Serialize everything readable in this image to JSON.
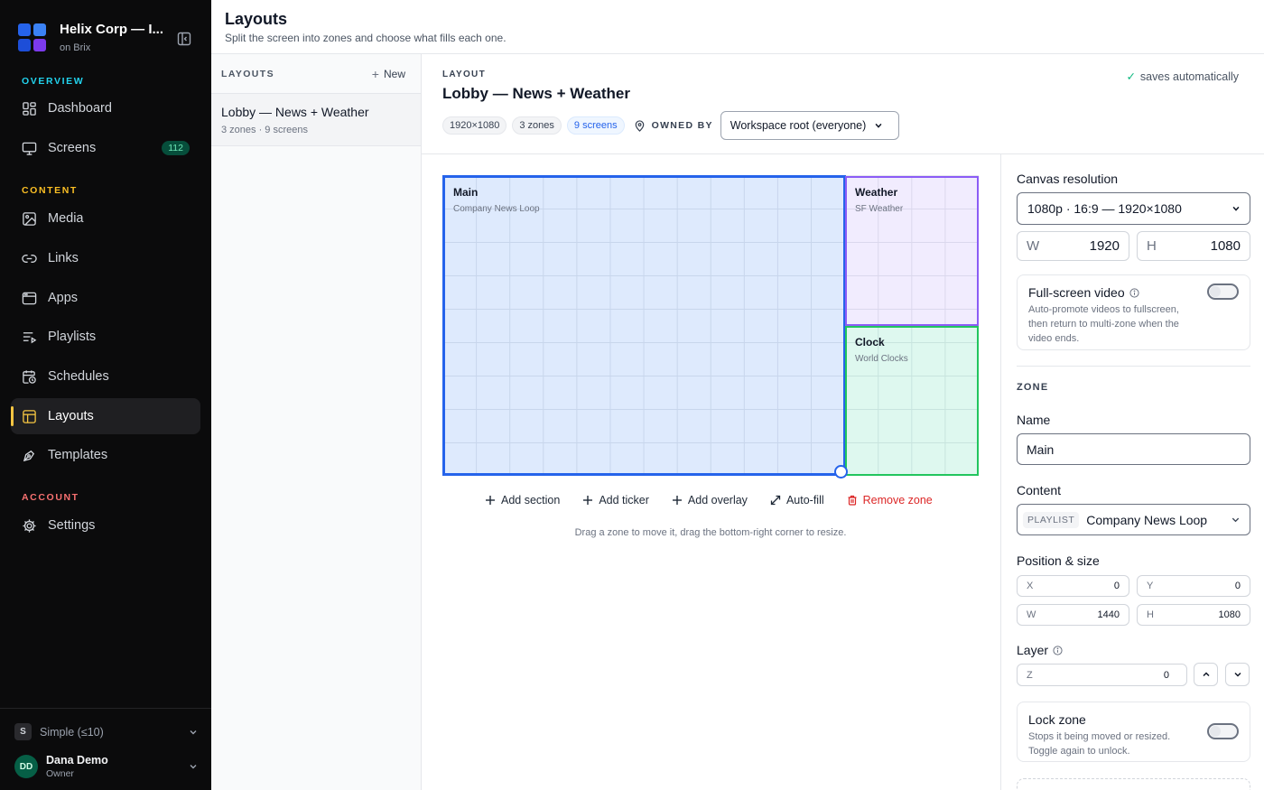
{
  "sidebar": {
    "brand_name": "Helix Corp — I...",
    "brand_sub": "on Brix",
    "logo_colors": [
      "#2563eb",
      "#3b82f6",
      "#1d4ed8",
      "#7c3aed"
    ],
    "sections": {
      "overview": "OVERVIEW",
      "content": "CONTENT",
      "account": "ACCOUNT"
    },
    "section_colors": {
      "overview": "#22d3ee",
      "content": "#fbbf24",
      "account": "#f87171"
    },
    "items": [
      {
        "label": "Dashboard",
        "icon": "dashboard-icon"
      },
      {
        "label": "Screens",
        "icon": "monitor-icon",
        "badge": "112"
      },
      {
        "label": "Media",
        "icon": "image-icon"
      },
      {
        "label": "Links",
        "icon": "link-icon"
      },
      {
        "label": "Apps",
        "icon": "app-window-icon"
      },
      {
        "label": "Playlists",
        "icon": "playlist-icon"
      },
      {
        "label": "Schedules",
        "icon": "calendar-clock-icon"
      },
      {
        "label": "Layouts",
        "icon": "layout-icon",
        "active": true
      },
      {
        "label": "Templates",
        "icon": "pen-tool-icon"
      },
      {
        "label": "Settings",
        "icon": "gear-icon"
      }
    ],
    "plan": {
      "letter": "S",
      "label": "Simple (≤10)"
    },
    "user": {
      "initials": "DD",
      "name": "Dana Demo",
      "role": "Owner"
    }
  },
  "header": {
    "title": "Layouts",
    "subtitle": "Split the screen into zones and choose what fills each one."
  },
  "layouts_panel": {
    "title": "LAYOUTS",
    "new_label": "New",
    "items": [
      {
        "name": "Lobby — News + Weather",
        "meta": "3 zones · 9 screens"
      }
    ]
  },
  "editor": {
    "label": "LAYOUT",
    "title": "Lobby — News + Weather",
    "saves": "saves automatically",
    "chips": {
      "resolution": "1920×1080",
      "zones": "3 zones",
      "screens": "9 screens"
    },
    "owned_by_label": "OWNED BY",
    "owner": "Workspace root (everyone)",
    "zones": [
      {
        "name": "Main",
        "content": "Company News Loop",
        "color": "#2563eb"
      },
      {
        "name": "Weather",
        "content": "SF Weather",
        "color": "#8b5cf6"
      },
      {
        "name": "Clock",
        "content": "World Clocks",
        "color": "#22c55e"
      }
    ],
    "toolbar": {
      "add_section": "Add section",
      "add_ticker": "Add ticker",
      "add_overlay": "Add overlay",
      "auto_fill": "Auto-fill",
      "remove_zone": "Remove zone"
    },
    "hint": "Drag a zone to move it, drag the bottom-right corner to resize."
  },
  "properties": {
    "canvas_resolution_label": "Canvas resolution",
    "resolution_value": "1080p · 16:9 — 1920×1080",
    "w_label": "W",
    "w_value": "1920",
    "h_label": "H",
    "h_value": "1080",
    "fullscreen": {
      "title": "Full-screen video",
      "desc": "Auto-promote videos to fullscreen, then return to multi-zone when the video ends.",
      "enabled": false
    },
    "zone_section": "ZONE",
    "name_label": "Name",
    "name_value": "Main",
    "content_label": "Content",
    "content_tag": "PLAYLIST",
    "content_value": "Company News Loop",
    "position_label": "Position & size",
    "pos": {
      "x_label": "X",
      "x": "0",
      "y_label": "Y",
      "y": "0",
      "w_label": "W",
      "w": "1440",
      "h_label": "H",
      "h": "1080"
    },
    "layer_label": "Layer",
    "z_label": "Z",
    "z_value": "0",
    "lock": {
      "title": "Lock zone",
      "desc": "Stops it being moved or resized. Toggle again to unlock.",
      "enabled": false
    }
  }
}
